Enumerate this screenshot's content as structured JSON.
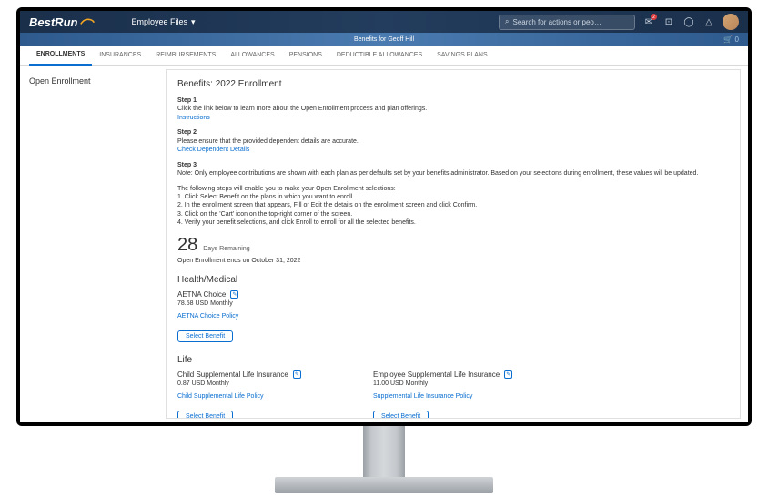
{
  "header": {
    "logo_text": "BestRun",
    "employee_files": "Employee Files",
    "search_placeholder": "Search for actions or peo…",
    "notif_count": "2"
  },
  "benefits_bar": {
    "text": "Benefits for Geoff Hill",
    "cart_count": "0"
  },
  "tabs": [
    "ENROLLMENTS",
    "INSURANCES",
    "REIMBURSEMENTS",
    "ALLOWANCES",
    "PENSIONS",
    "DEDUCTIBLE ALLOWANCES",
    "SAVINGS PLANS"
  ],
  "sidebar": {
    "title": "Open Enrollment"
  },
  "main": {
    "title": "Benefits: 2022 Enrollment",
    "step1": {
      "title": "Step 1",
      "text": "Click the link below to learn more about the Open Enrollment process and plan offerings.",
      "link": "Instructions"
    },
    "step2": {
      "title": "Step 2",
      "text": "Please ensure that the provided dependent details are accurate.",
      "link": "Check Dependent Details"
    },
    "step3": {
      "title": "Step 3",
      "text": "Note: Only employee contributions are shown with each plan as per defaults set by your benefits administrator. Based on your selections during enrollment, these values will be updated."
    },
    "instructions": {
      "intro": "The following steps will enable you to make your Open Enrollment selections:",
      "l1": "1. Click Select Benefit on the plans in which you want to enroll.",
      "l2": "2. In the enrollment screen that appears, Fill or Edit the details on the enrollment screen and click Confirm.",
      "l3": "3. Click on the 'Cart' icon on the top-right corner of the screen.",
      "l4": "4. Verify your benefit selections, and click Enroll to enroll for all the selected benefits."
    },
    "days": {
      "num": "28",
      "label": "Days Remaining",
      "sub": "Open Enrollment ends on October 31, 2022"
    },
    "health": {
      "title": "Health/Medical",
      "plan": "AETNA Choice",
      "cost": "78.58 USD Monthly",
      "policy": "AETNA Choice Policy",
      "btn": "Select Benefit"
    },
    "life": {
      "title": "Life",
      "child": {
        "name": "Child Supplemental Life Insurance",
        "cost": "0.87 USD Monthly",
        "policy": "Child Supplemental Life Policy",
        "btn": "Select Benefit"
      },
      "emp": {
        "name": "Employee Supplemental Life Insurance",
        "cost": "11.00 USD Monthly",
        "policy": "Supplemental Life Insurance Policy",
        "btn": "Select Benefit"
      }
    }
  }
}
